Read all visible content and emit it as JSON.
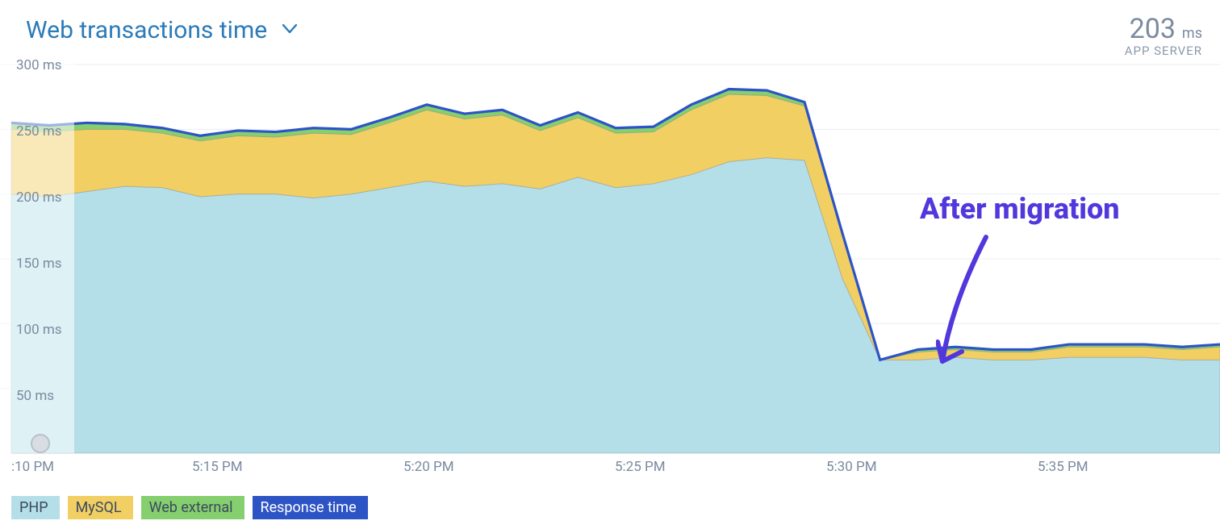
{
  "header": {
    "title": "Web transactions time",
    "metric_value": "203",
    "metric_unit": "ms",
    "metric_sub": "APP SERVER"
  },
  "legend": {
    "php": "PHP",
    "mysql": "MySQL",
    "web_external": "Web external",
    "response_time": "Response time"
  },
  "annotation": {
    "text": "After migration"
  },
  "axes": {
    "y": {
      "t300": "300 ms",
      "t250": "250 ms",
      "t200": "200 ms",
      "t150": "150 ms",
      "t100": "100 ms",
      "t50": "50 ms"
    },
    "x": {
      "t10": ":10 PM",
      "t15": "5:15 PM",
      "t20": "5:20 PM",
      "t25": "5:25 PM",
      "t30": "5:30 PM",
      "t35": "5:35 PM"
    }
  },
  "chart_data": {
    "type": "area",
    "stacked": true,
    "xlabel": "",
    "ylabel": "",
    "y_unit": "ms",
    "ylim": [
      0,
      300
    ],
    "x_times": [
      "5:10",
      "5:11",
      "5:12",
      "5:13",
      "5:14",
      "5:15",
      "5:16",
      "5:17",
      "5:18",
      "5:19",
      "5:20",
      "5:21",
      "5:22",
      "5:23",
      "5:24",
      "5:25",
      "5:26",
      "5:27",
      "5:28",
      "5:29",
      "5:30",
      "5:31",
      "5:32",
      "5:33",
      "5:34",
      "5:35",
      "5:36",
      "5:37",
      "5:38"
    ],
    "series": [
      {
        "name": "PHP",
        "color": "#b5dfe8",
        "values": [
          200,
          198,
          202,
          206,
          205,
          198,
          200,
          200,
          197,
          200,
          205,
          210,
          206,
          208,
          204,
          213,
          205,
          208,
          215,
          225,
          228,
          226,
          135,
          72,
          72,
          74,
          72,
          72,
          74,
          74,
          74,
          72,
          72
        ]
      },
      {
        "name": "MySQL",
        "color": "#f2cf63",
        "values": [
          50,
          50,
          48,
          44,
          42,
          43,
          45,
          44,
          50,
          46,
          50,
          55,
          52,
          53,
          45,
          46,
          42,
          40,
          50,
          52,
          48,
          42,
          33,
          0,
          6,
          6,
          6,
          6,
          8,
          8,
          8,
          8,
          10
        ]
      },
      {
        "name": "Web external",
        "color": "#86cf6e",
        "values": [
          5,
          5,
          5,
          4,
          4,
          4,
          4,
          4,
          4,
          4,
          4,
          4,
          4,
          4,
          4,
          4,
          4,
          4,
          4,
          4,
          4,
          3,
          2,
          0,
          2,
          2,
          2,
          2,
          2,
          2,
          2,
          2,
          2
        ]
      }
    ],
    "response_time_line": {
      "name": "Response time",
      "color": "#2d54c5",
      "values": [
        255,
        253,
        255,
        254,
        251,
        245,
        249,
        248,
        251,
        250,
        259,
        269,
        262,
        265,
        253,
        263,
        251,
        252,
        269,
        281,
        280,
        271,
        170,
        72,
        80,
        82,
        80,
        80,
        84,
        84,
        84,
        82,
        84
      ]
    },
    "annotations": [
      {
        "text": "After migration",
        "at_x": "5:32"
      }
    ],
    "legend_position": "bottom-left"
  }
}
